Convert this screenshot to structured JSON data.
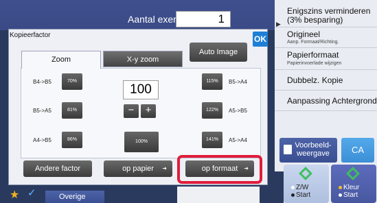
{
  "header": {
    "copies_label": "Aantal exempl.",
    "copies_value": "1"
  },
  "right_panel": {
    "items": [
      {
        "label": "Enigszins verminderen (3% besparing)",
        "sub": ""
      },
      {
        "label": "Origineel",
        "sub": "Aanp. Formaat/Richting."
      },
      {
        "label": "Papierformaat",
        "sub": "Papierinvoerlade wijzigen"
      },
      {
        "label": "Dubbelz. Kopie",
        "sub": ""
      },
      {
        "label": "Aanpassing Achtergrond",
        "sub": ""
      }
    ],
    "preview_label": "Voorbeeld-weergave",
    "ca_label": "CA",
    "bw_start_label": "Z/W Start",
    "color_start_label": "Kleur Start",
    "accent_color": "#3c8fd6",
    "start_icon_color": "#3fbf5f"
  },
  "bottom": {
    "overige_label": "Overige",
    "star_icon": "star-icon",
    "check_icon": "check-icon"
  },
  "dialog": {
    "title": "Kopieerfactor",
    "ok_label": "OK",
    "auto_image_label": "Auto Image",
    "tabs": [
      {
        "label": "Zoom"
      },
      {
        "label": "X-y zoom"
      }
    ],
    "zoom_value": "100",
    "minus_label": "−",
    "plus_label": "+",
    "pct100_label": "100%",
    "left_ratios": [
      {
        "label": "B4->B5",
        "pct": "70%"
      },
      {
        "label": "B5->A5",
        "pct": "81%"
      },
      {
        "label": "A4->B5",
        "pct": "86%"
      }
    ],
    "right_ratios": [
      {
        "label": "B5->A4",
        "pct": "115%"
      },
      {
        "label": "A5->B5",
        "pct": "122%"
      },
      {
        "label": "A5->A4",
        "pct": "141%"
      }
    ],
    "actions": [
      {
        "label": "Andere factor"
      },
      {
        "label": "op papier"
      },
      {
        "label": "op formaat"
      }
    ],
    "highlight_color": "#e01d3c"
  }
}
